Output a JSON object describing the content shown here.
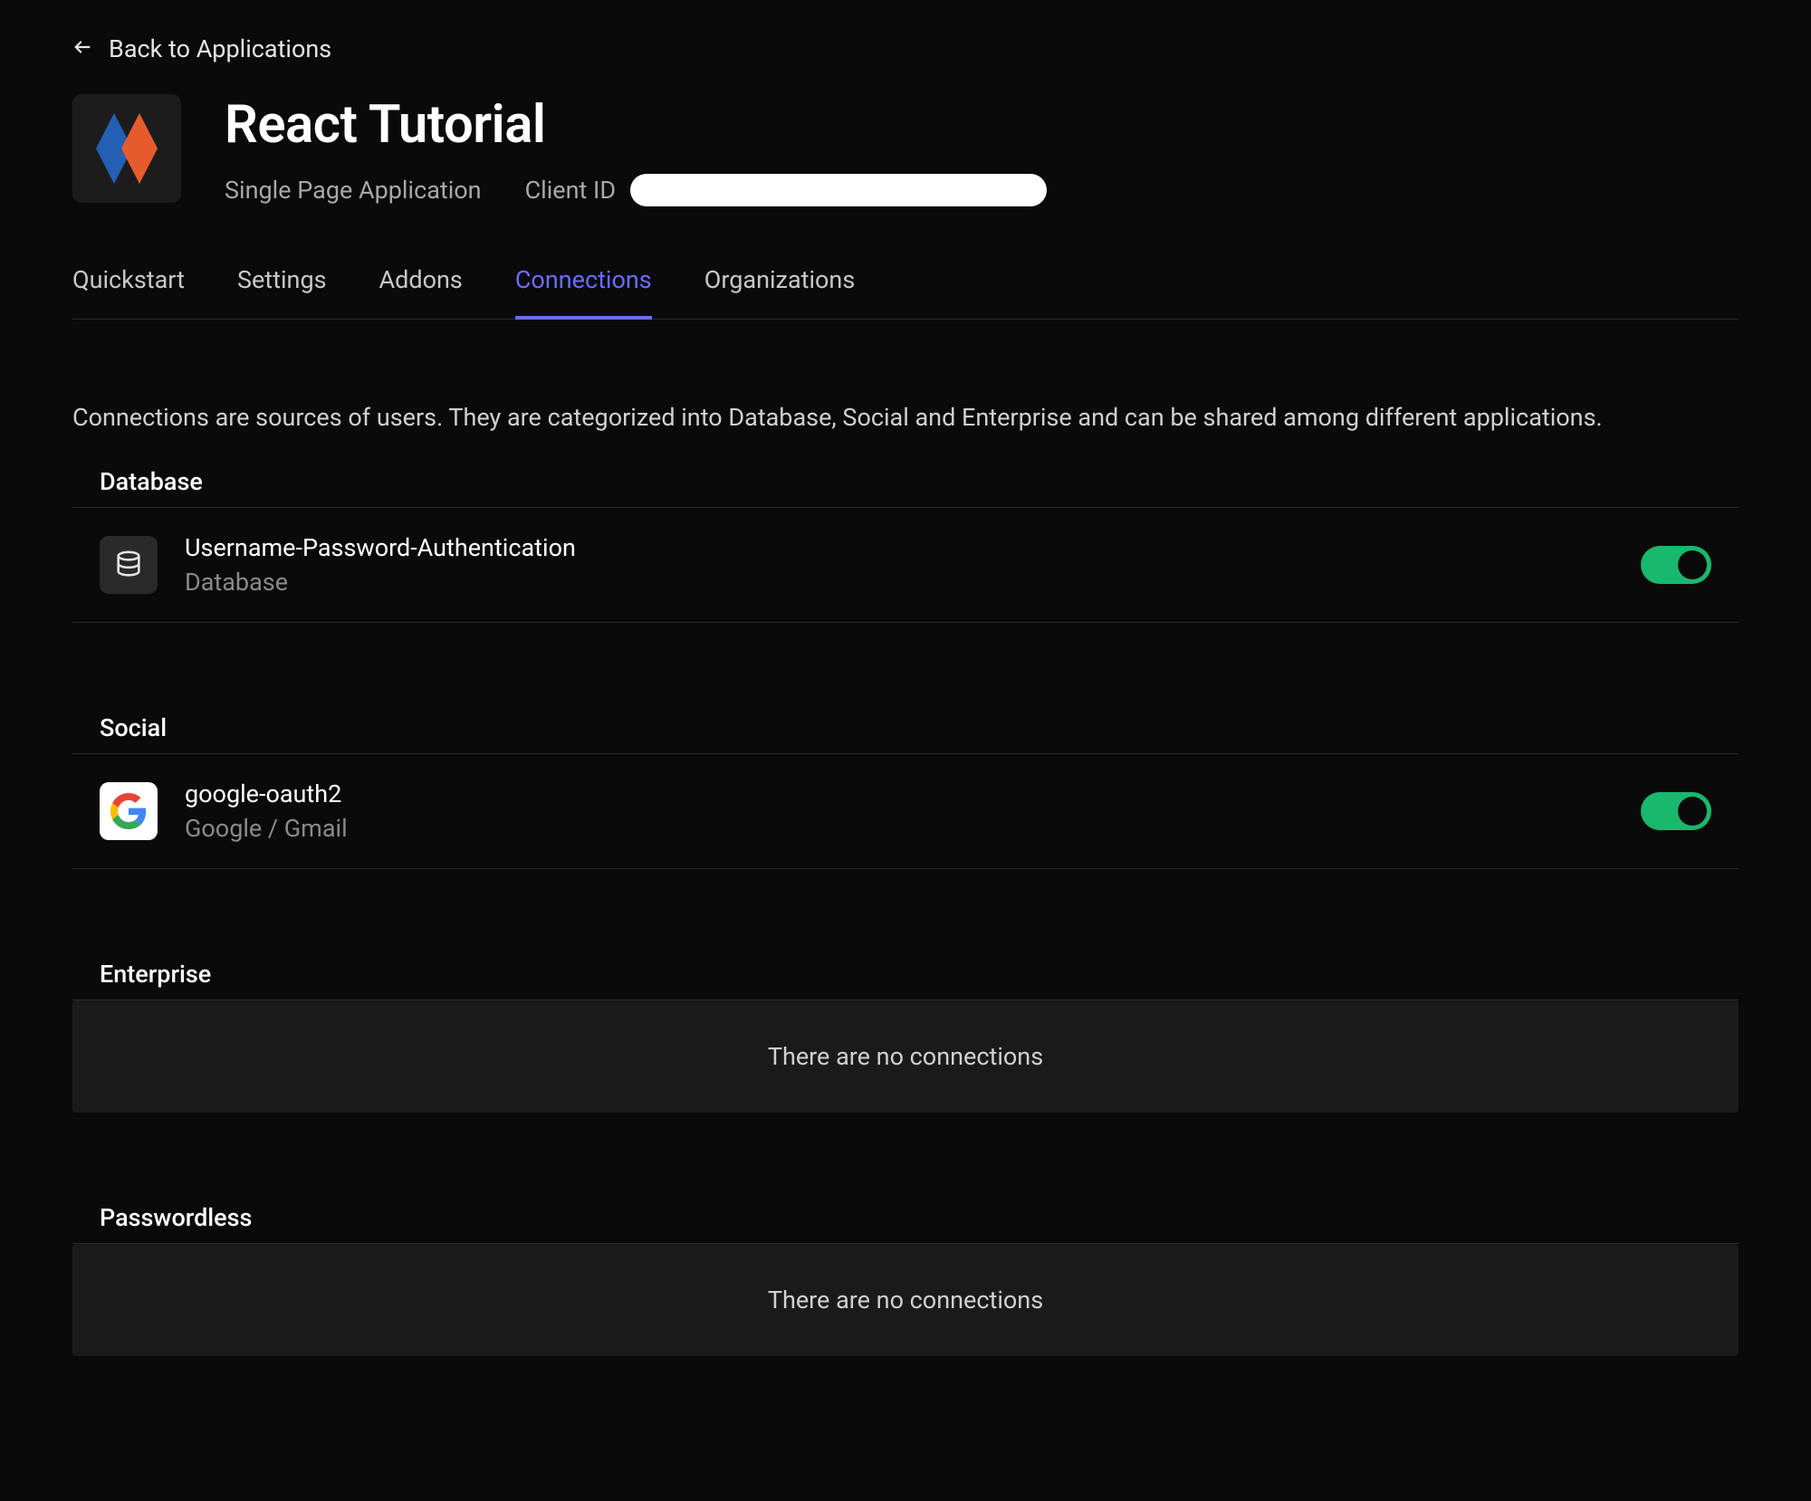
{
  "back_link": {
    "label": "Back to Applications"
  },
  "app": {
    "title": "React Tutorial",
    "type_label": "Single Page Application",
    "client_id_label": "Client ID"
  },
  "tabs": [
    {
      "label": "Quickstart",
      "active": false
    },
    {
      "label": "Settings",
      "active": false
    },
    {
      "label": "Addons",
      "active": false
    },
    {
      "label": "Connections",
      "active": true
    },
    {
      "label": "Organizations",
      "active": false
    }
  ],
  "description": "Connections are sources of users. They are categorized into Database, Social and Enterprise and can be shared among different applications.",
  "sections": {
    "database": {
      "heading": "Database",
      "connections": [
        {
          "name": "Username-Password-Authentication",
          "subtitle": "Database",
          "icon": "database",
          "enabled": true
        }
      ]
    },
    "social": {
      "heading": "Social",
      "connections": [
        {
          "name": "google-oauth2",
          "subtitle": "Google / Gmail",
          "icon": "google",
          "enabled": true
        }
      ]
    },
    "enterprise": {
      "heading": "Enterprise",
      "empty_message": "There are no connections"
    },
    "passwordless": {
      "heading": "Passwordless",
      "empty_message": "There are no connections"
    }
  }
}
